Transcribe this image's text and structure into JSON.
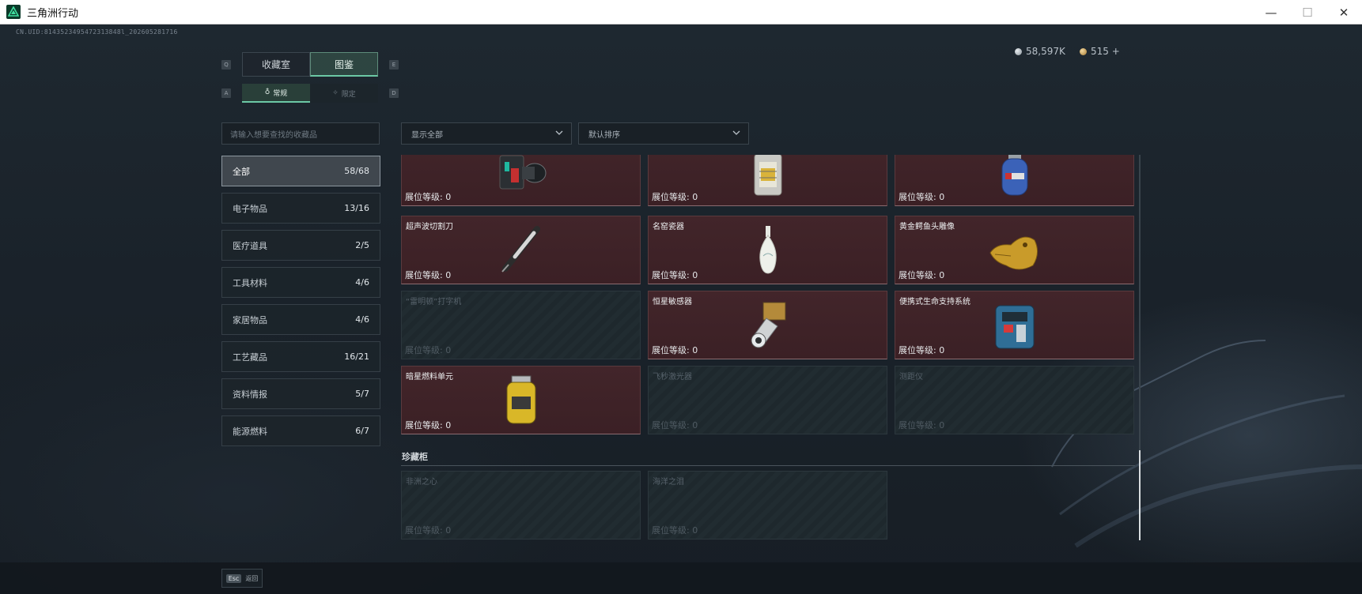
{
  "window": {
    "title": "三角洲行动",
    "minimize": "—",
    "maximize": "☐",
    "close": "✕"
  },
  "uid": "CN.UID:8143523495472313848l_202605281716",
  "currency": {
    "silver": "58,597K",
    "gold": "515 +"
  },
  "tabs": {
    "left_key": "Q",
    "right_key": "E",
    "items": [
      {
        "label": "收藏室"
      },
      {
        "label": "图鉴"
      }
    ]
  },
  "subtabs": {
    "left_key": "A",
    "right_key": "D",
    "items": [
      {
        "label": "常规"
      },
      {
        "label": "限定"
      }
    ]
  },
  "search": {
    "placeholder": "请输入想要查找的收藏品"
  },
  "filters": {
    "display": "显示全部",
    "sort": "默认排序"
  },
  "categories": [
    {
      "label": "全部",
      "count": "58/68"
    },
    {
      "label": "电子物品",
      "count": "13/16"
    },
    {
      "label": "医疗道具",
      "count": "2/5"
    },
    {
      "label": "工具材料",
      "count": "4/6"
    },
    {
      "label": "家居物品",
      "count": "4/6"
    },
    {
      "label": "工艺藏品",
      "count": "16/21"
    },
    {
      "label": "资料情报",
      "count": "5/7"
    },
    {
      "label": "能源燃料",
      "count": "6/7"
    }
  ],
  "cards": [
    {
      "name": "",
      "level": "展位等级:  0",
      "owned": true,
      "art": "device"
    },
    {
      "name": "",
      "level": "展位等级:  0",
      "owned": true,
      "art": "lamp"
    },
    {
      "name": "",
      "level": "展位等级:  0",
      "owned": true,
      "art": "tank"
    },
    {
      "name": "超声波切割刀",
      "level": "展位等级:  0",
      "owned": true,
      "art": "knife"
    },
    {
      "name": "名窑瓷器",
      "level": "展位等级:  0",
      "owned": true,
      "art": "vase"
    },
    {
      "name": "黄金鳄鱼头雕像",
      "level": "展位等级:  0",
      "owned": true,
      "art": "croc"
    },
    {
      "name": "“雷明顿”打字机",
      "level": "展位等级:  0",
      "owned": false,
      "art": "none"
    },
    {
      "name": "恒星敏感器",
      "level": "展位等级:  0",
      "owned": true,
      "art": "sensor"
    },
    {
      "name": "便携式生命支持系统",
      "level": "展位等级:  0",
      "owned": true,
      "art": "pls"
    },
    {
      "name": "暗星燃料单元",
      "level": "展位等级:  0",
      "owned": true,
      "art": "fuel"
    },
    {
      "name": "飞秒激光器",
      "level": "展位等级:  0",
      "owned": false,
      "art": "none"
    },
    {
      "name": "测距仪",
      "level": "展位等级:  0",
      "owned": false,
      "art": "none"
    }
  ],
  "section": {
    "title": "珍藏柜",
    "cards": [
      {
        "name": "非洲之心",
        "level": "展位等级:  0",
        "owned": false
      },
      {
        "name": "海洋之泪",
        "level": "展位等级:  0",
        "owned": false
      }
    ]
  },
  "footer": {
    "esc_key": "Esc",
    "esc_label": "返回"
  },
  "colors": {
    "accent": "#6cc8a5",
    "owned_card": "#3f2227",
    "locked_card": "#1e282d"
  }
}
